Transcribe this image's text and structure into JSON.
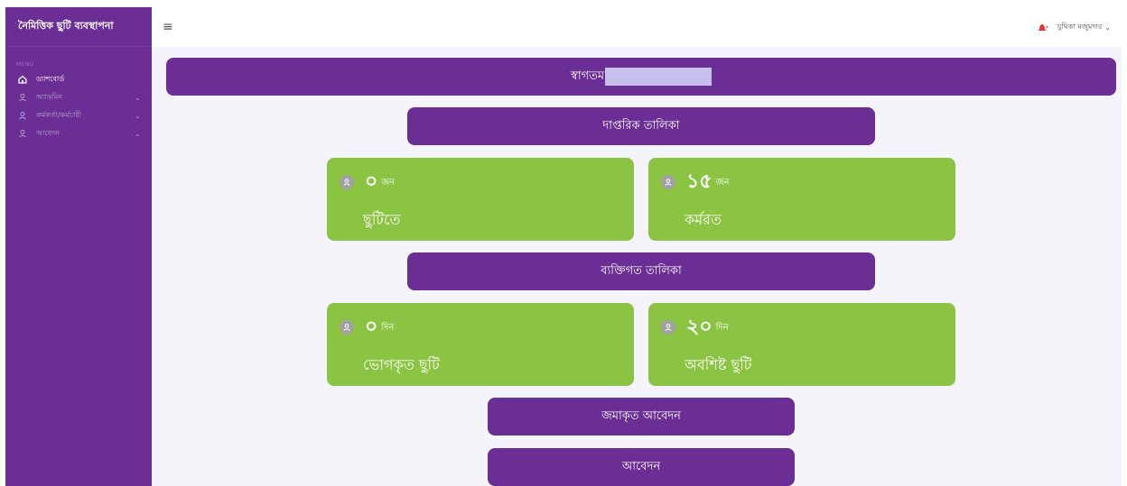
{
  "sidebar": {
    "brand": "নৈমিত্তিক ছুটি ব্যবস্থাপনা",
    "menu_header": "MENU",
    "items": [
      {
        "label": "ড্যাশবোর্ড",
        "icon": "home-icon",
        "active": true
      },
      {
        "label": "অ্যাডমিন",
        "icon": "user-icon"
      },
      {
        "label": "কর্মকর্তা/কর্মচারী",
        "icon": "user-icon"
      },
      {
        "label": "আবেদন",
        "icon": "user-icon"
      }
    ]
  },
  "topbar": {
    "menu_icon": "hamburger-icon",
    "notification_icon": "bell-icon",
    "username": "যুথিকা মজুমদার"
  },
  "main": {
    "welcome": "স্বাগতম",
    "office_list": "দাপ্তরিক তালিকা",
    "office_cards": [
      {
        "value": "০",
        "unit": "জন",
        "caption": "ছুটিতে"
      },
      {
        "value": "১৫",
        "unit": "জন",
        "caption": "কর্মরত"
      }
    ],
    "personal_list": "ব্যক্তিগত তালিকা",
    "personal_cards": [
      {
        "value": "০",
        "unit": "দিন",
        "caption": "ভোগকৃত ছুটি"
      },
      {
        "value": "২০",
        "unit": "দিন",
        "caption": "অবশিষ্ট ছুটি"
      }
    ],
    "submitted_button": "জমাকৃত আবেদন",
    "apply_button": "আবেদন"
  },
  "colors": {
    "primary": "#6a2e94",
    "card_green": "#8bc443",
    "background": "#f5f4fb",
    "bell": "#e53935"
  }
}
